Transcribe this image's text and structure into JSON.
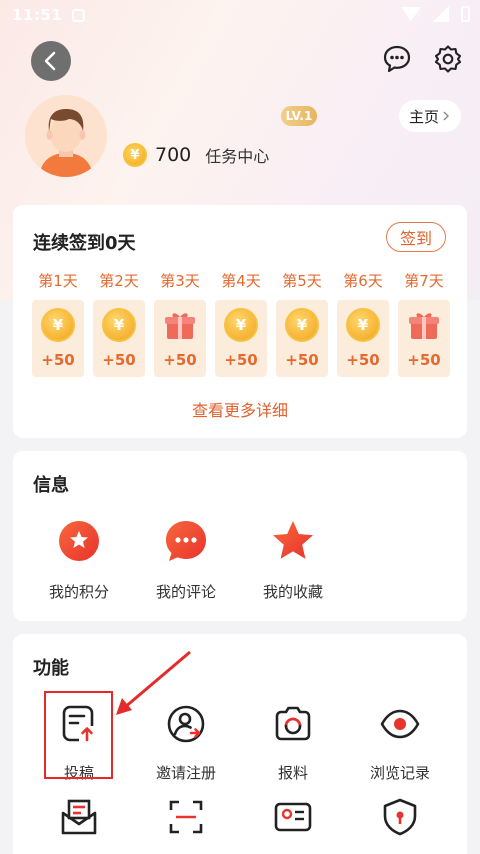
{
  "status_bar": {
    "time": "11:51"
  },
  "profile": {
    "level": "LV.1",
    "coins": "700",
    "task_center": "任务中心",
    "home_button": "主页"
  },
  "checkin": {
    "title": "连续签到0天",
    "button": "签到",
    "days": [
      {
        "label": "第1天",
        "reward": "+50",
        "icon": "coin-icon"
      },
      {
        "label": "第2天",
        "reward": "+50",
        "icon": "coin-icon"
      },
      {
        "label": "第3天",
        "reward": "+50",
        "icon": "gift-icon"
      },
      {
        "label": "第4天",
        "reward": "+50",
        "icon": "coin-icon"
      },
      {
        "label": "第5天",
        "reward": "+50",
        "icon": "coin-icon"
      },
      {
        "label": "第6天",
        "reward": "+50",
        "icon": "coin-icon"
      },
      {
        "label": "第7天",
        "reward": "+50",
        "icon": "gift-icon"
      }
    ],
    "more_link": "查看更多详细"
  },
  "info": {
    "title": "信息",
    "items": [
      {
        "label": "我的积分",
        "icon": "star-badge-icon"
      },
      {
        "label": "我的评论",
        "icon": "comment-bubble-icon"
      },
      {
        "label": "我的收藏",
        "icon": "star-icon"
      }
    ]
  },
  "functions": {
    "title": "功能",
    "items": [
      {
        "label": "投稿",
        "icon": "submit-document-icon"
      },
      {
        "label": "邀请注册",
        "icon": "invite-user-icon"
      },
      {
        "label": "报料",
        "icon": "camera-icon"
      },
      {
        "label": "浏览记录",
        "icon": "eye-icon"
      }
    ]
  },
  "colors": {
    "accent": "#e0622f",
    "highlight": "#e52a2a",
    "coin": "#f2a31a"
  }
}
